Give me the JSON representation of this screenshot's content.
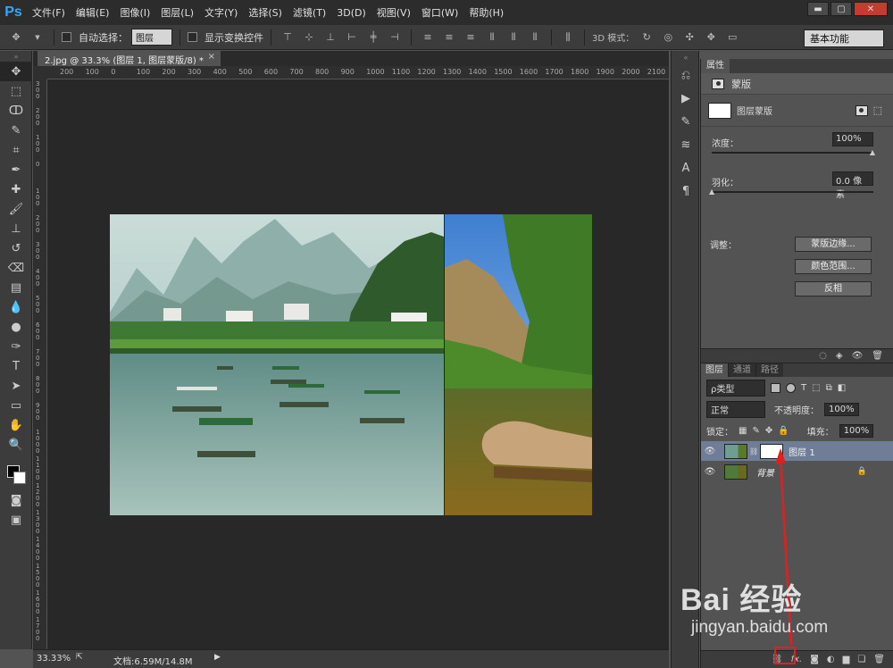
{
  "app": {
    "logo": "Ps",
    "menu": [
      "文件(F)",
      "编辑(E)",
      "图像(I)",
      "图层(L)",
      "文字(Y)",
      "选择(S)",
      "滤镜(T)",
      "3D(D)",
      "视图(V)",
      "窗口(W)",
      "帮助(H)"
    ],
    "window_controls": {
      "minimize": "▬",
      "maximize": "▢",
      "close": "✕"
    }
  },
  "options_bar": {
    "auto_select_label": "自动选择：",
    "auto_select_value": "图层",
    "show_transform_label": "显示变换控件",
    "mode_3d_label": "3D 模式：",
    "workspace": "基本功能"
  },
  "document": {
    "tab_title": "2.jpg @ 33.3% (图层 1, 图层蒙版/8) *",
    "close_glyph": "×",
    "h_ruler": [
      "200",
      "100",
      "0",
      "100",
      "200",
      "300",
      "400",
      "500",
      "600",
      "700",
      "800",
      "900",
      "1000",
      "1100",
      "1200",
      "1300",
      "1400",
      "1500",
      "1600",
      "1700",
      "1800",
      "1900",
      "2000",
      "2100"
    ],
    "v_ruler": [
      "300",
      "200",
      "100",
      "0",
      "100",
      "200",
      "300",
      "400",
      "500",
      "600",
      "700",
      "800",
      "900",
      "1000",
      "1100",
      "1200",
      "1300",
      "1400",
      "1500",
      "1600",
      "1700"
    ]
  },
  "status": {
    "zoom": "33.33%",
    "doc_info": "文档:6.59M/14.8M",
    "arrow": "▶"
  },
  "properties": {
    "tab": "属性",
    "type_label": "蒙版",
    "mask_label": "图层蒙版",
    "density_label": "浓度：",
    "density_value": "100%",
    "feather_label": "羽化：",
    "feather_value": "0.0 像素",
    "adjust_label": "调整：",
    "buttons": [
      "蒙版边缘...",
      "颜色范围...",
      "反相"
    ]
  },
  "layers": {
    "tabs": [
      "图层",
      "通道",
      "路径"
    ],
    "filter_kind": "ρ类型",
    "blend_mode": "正常",
    "opacity_label": "不透明度：",
    "opacity_value": "100%",
    "lock_label": "锁定：",
    "fill_label": "填充：",
    "fill_value": "100%",
    "items": [
      {
        "name": "图层 1",
        "selected": true,
        "has_mask": true
      },
      {
        "name": "背景",
        "selected": false,
        "locked": true
      }
    ],
    "footer_icons": [
      "link-icon",
      "fx-icon",
      "add-mask-icon",
      "adjustment-icon",
      "group-icon",
      "new-layer-icon",
      "delete-icon"
    ]
  },
  "watermark": {
    "brand": "Bai 经验",
    "url": "jingyan.baidu.com"
  },
  "colors": {
    "accent": "#31a8ff",
    "highlight": "#e02020",
    "selected_layer": "#6f7d96"
  }
}
